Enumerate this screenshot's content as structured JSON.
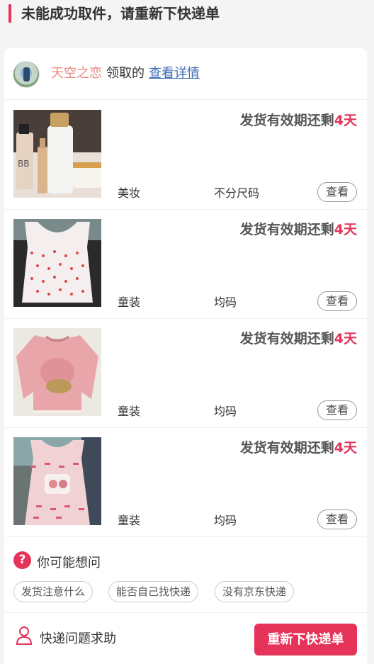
{
  "header": {
    "title": "未能成功取件，请重新下快递单"
  },
  "user": {
    "name": "天空之恋",
    "action": "领取的",
    "link": "查看详情"
  },
  "items": [
    {
      "deadline_prefix": "发货有效期还剩",
      "deadline_days": "4天",
      "category": "美妆",
      "size": "不分尺码",
      "view_label": "查看",
      "image": "cosmetics-photo"
    },
    {
      "deadline_prefix": "发货有效期还剩",
      "deadline_days": "4天",
      "category": "童装",
      "size": "均码",
      "view_label": "查看",
      "image": "white-tank-top-photo"
    },
    {
      "deadline_prefix": "发货有效期还剩",
      "deadline_days": "4天",
      "category": "童装",
      "size": "均码",
      "view_label": "查看",
      "image": "pink-sweater-photo"
    },
    {
      "deadline_prefix": "发货有效期还剩",
      "deadline_days": "4天",
      "category": "童装",
      "size": "均码",
      "view_label": "查看",
      "image": "pink-dress-photo"
    }
  ],
  "faq": {
    "title": "你可能想问",
    "icon": "question-icon",
    "chips": [
      "发货注意什么",
      "能否自己找快递",
      "没有京东快递"
    ]
  },
  "bottom": {
    "help_label": "快递问题求助",
    "help_icon": "person-icon",
    "reorder_label": "重新下快递单"
  },
  "colors": {
    "accent": "#e5335a",
    "link": "#3d6bb3",
    "username": "#e58a80"
  }
}
